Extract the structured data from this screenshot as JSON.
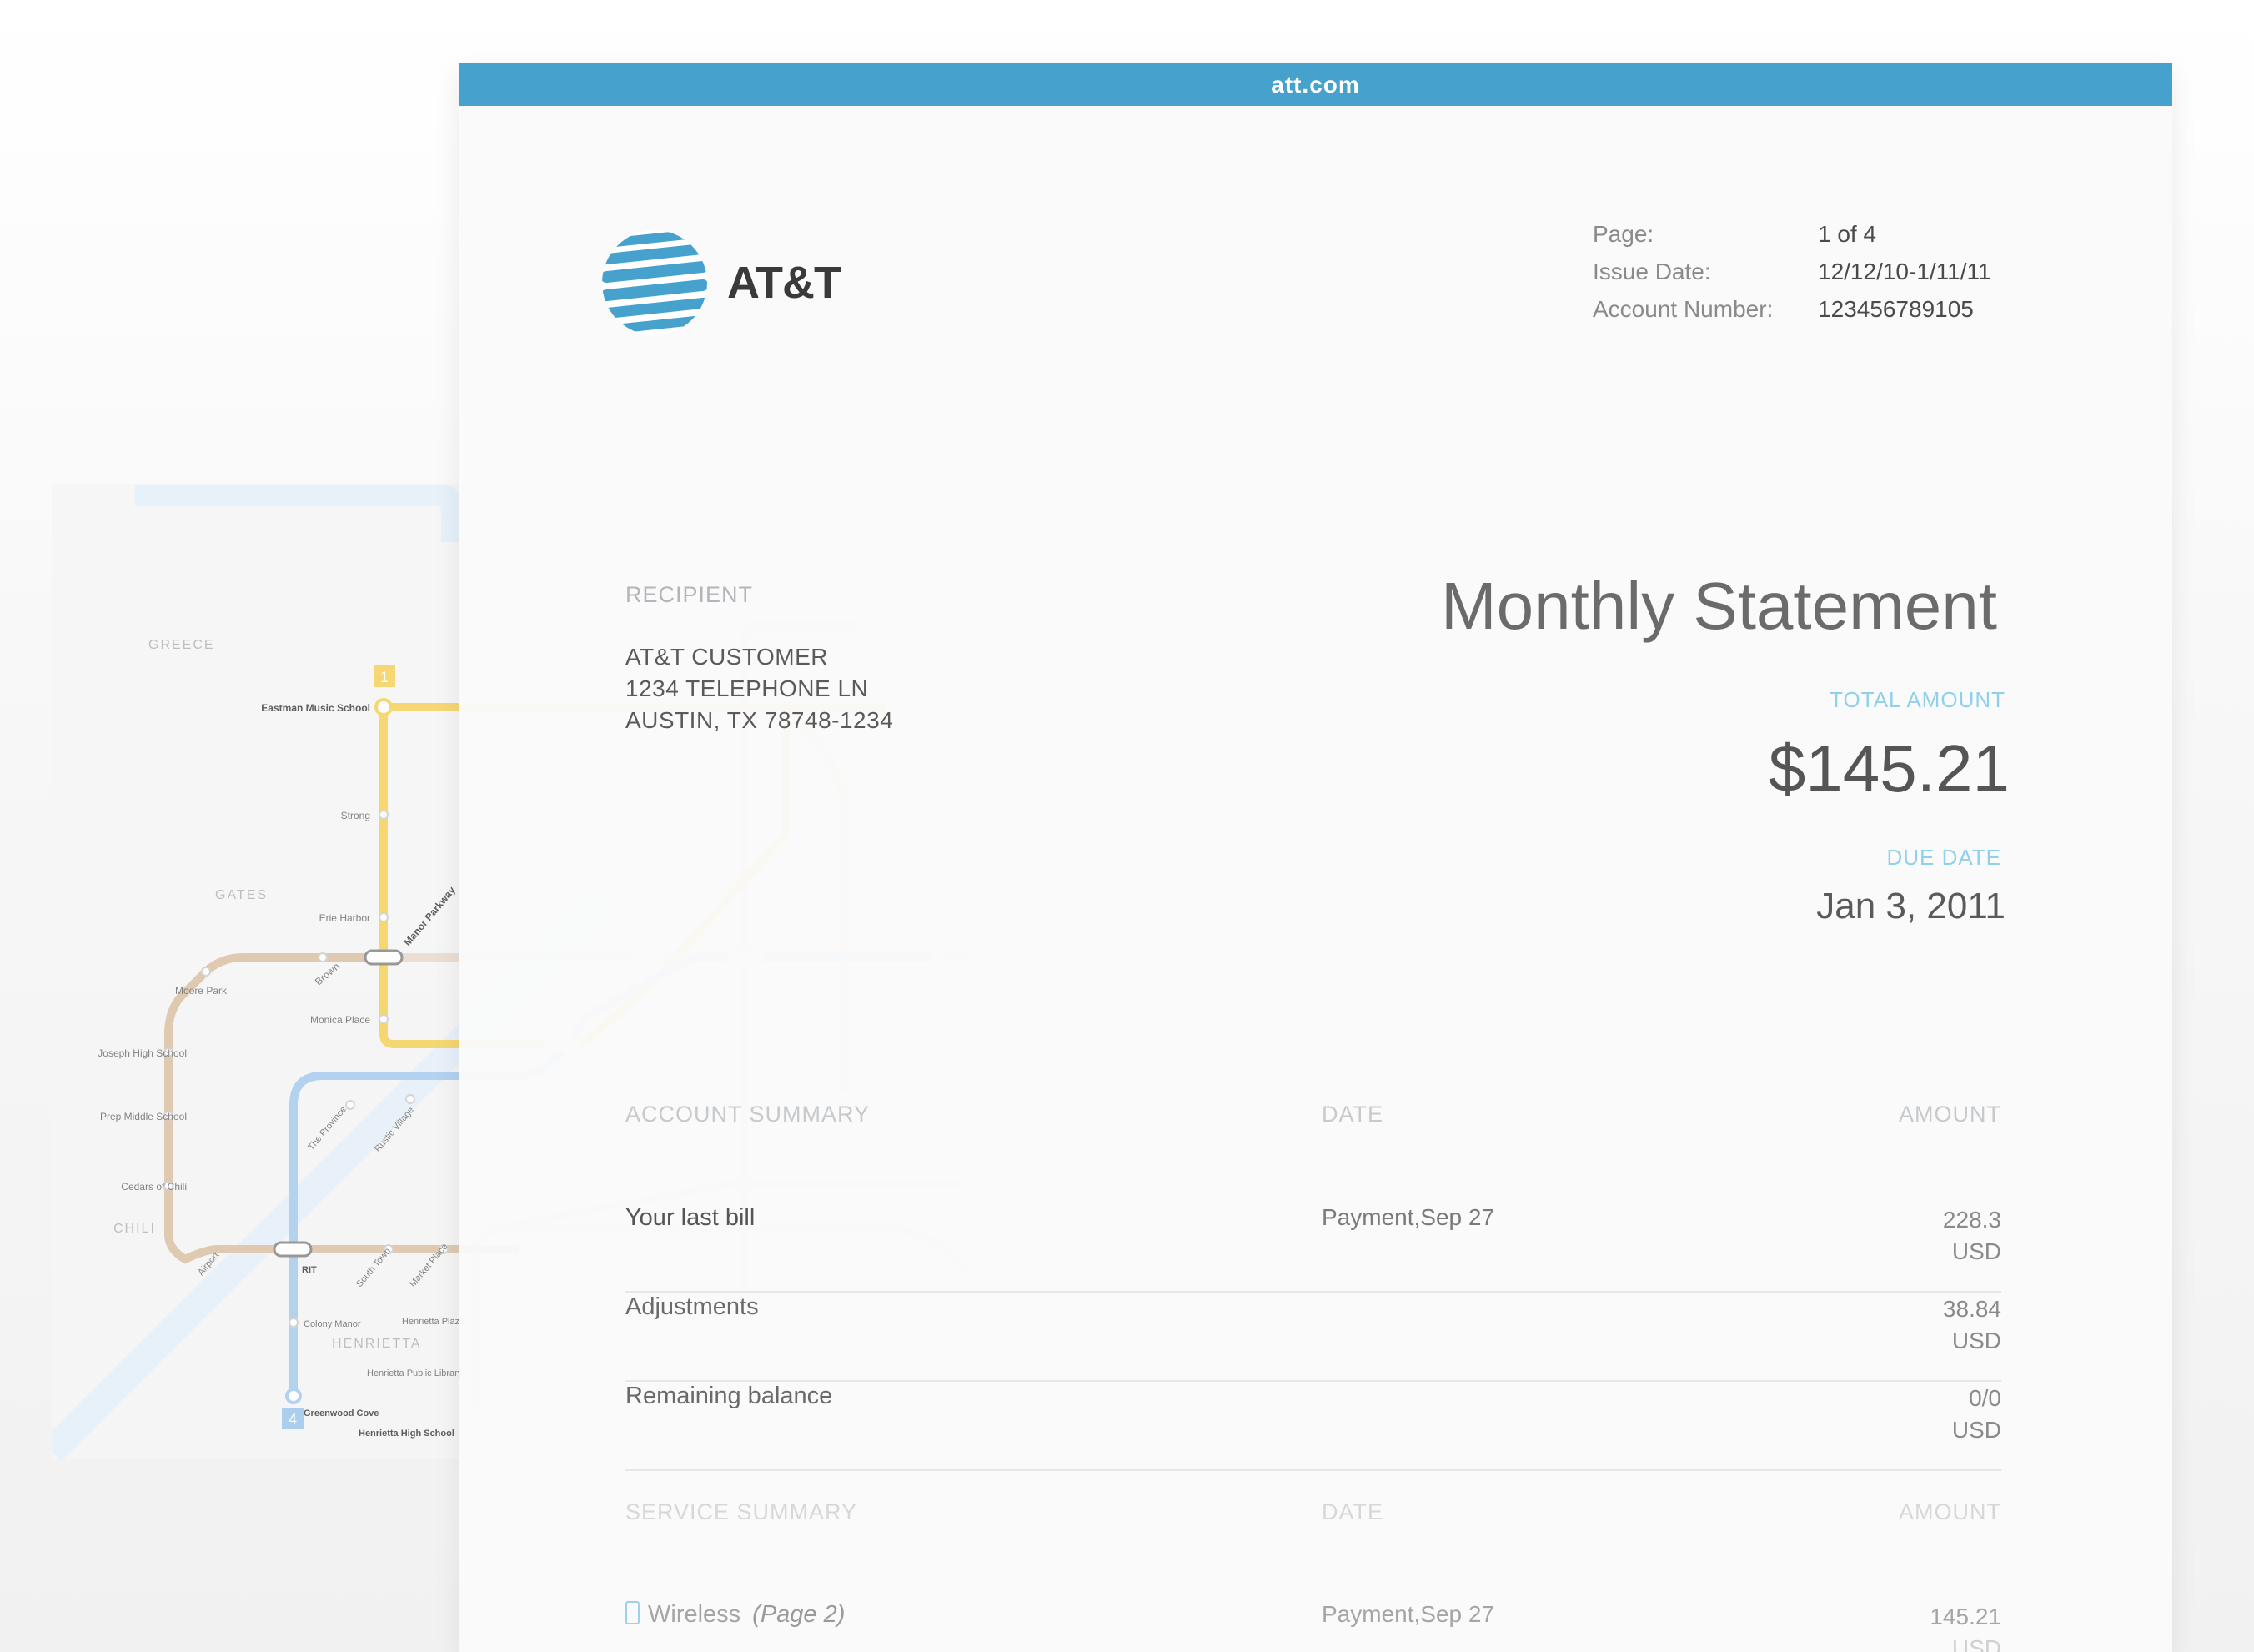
{
  "browser": {
    "url": "att.com"
  },
  "brand": {
    "name": "AT&T",
    "color": "#46a2cc"
  },
  "meta": {
    "page_label": "Page:",
    "page_value": "1 of 4",
    "issue_label": "Issue Date:",
    "issue_value": "12/12/10-1/11/11",
    "account_label": "Account Number:",
    "account_value": "123456789105"
  },
  "recipient": {
    "heading": "RECIPIENT",
    "lines": [
      "AT&T CUSTOMER",
      "1234 TELEPHONE LN",
      "AUSTIN, TX 78748-1234"
    ]
  },
  "statement": {
    "title": "Monthly Statement",
    "total_label": "TOTAL AMOUNT",
    "total_value": "$145.21",
    "due_label": "DUE DATE",
    "due_value": "Jan 3, 2011"
  },
  "account_summary": {
    "heading": "ACCOUNT SUMMARY",
    "date_heading": "DATE",
    "amount_heading": "AMOUNT",
    "rows": [
      {
        "label": "Your last bill",
        "date": "Payment,Sep 27",
        "amount": "228.3",
        "currency": "USD"
      },
      {
        "label": "Adjustments",
        "date": "",
        "amount": "38.84",
        "currency": "USD"
      },
      {
        "label": "Remaining balance",
        "date": "",
        "amount": "0/0",
        "currency": "USD"
      }
    ]
  },
  "service_summary": {
    "heading": "SERVICE SUMMARY",
    "date_heading": "DATE",
    "amount_heading": "AMOUNT",
    "rows": [
      {
        "label": "Wireless",
        "page_ref": "(Page 2)",
        "icon": "phone-icon",
        "date": "Payment,Sep 27",
        "amount": "145.21",
        "currency": "USD"
      }
    ]
  },
  "map": {
    "regions": {
      "greece": "GREECE",
      "gates": "GATES",
      "chili": "CHILI",
      "henrietta": "HENRIETTA"
    },
    "line_badges": {
      "yellow": "1",
      "blue": "4"
    },
    "stations": {
      "eastman": "Eastman Music School",
      "strong": "Strong",
      "erie_harbor": "Erie Harbor",
      "manor_parkway": "Manor Parkway",
      "moore_park": "Moore Park",
      "brown": "Brown",
      "monica_place": "Monica Place",
      "joseph_high": "Joseph High School",
      "prep_middle": "Prep Middle School",
      "cedars": "Cedars of Chili",
      "airport": "Airport",
      "rit": "RIT",
      "the_province": "The Province",
      "rustic_village": "Rustic Village",
      "south_town": "South Town",
      "market_place": "Market Place",
      "colony_manor": "Colony Manor",
      "henrietta_plaza": "Henrietta Plaza",
      "henrietta_library": "Henrietta Public Library",
      "greenwood_cove": "Greenwood Cove",
      "henrietta_high": "Henrietta High School"
    },
    "colors": {
      "yellow": "#f6d25c",
      "tan": "#dcc2a6",
      "blue": "#a8cdee",
      "river": "#e4f0fb",
      "red": "#f3cfd1",
      "green": "#d4e6d8"
    }
  }
}
